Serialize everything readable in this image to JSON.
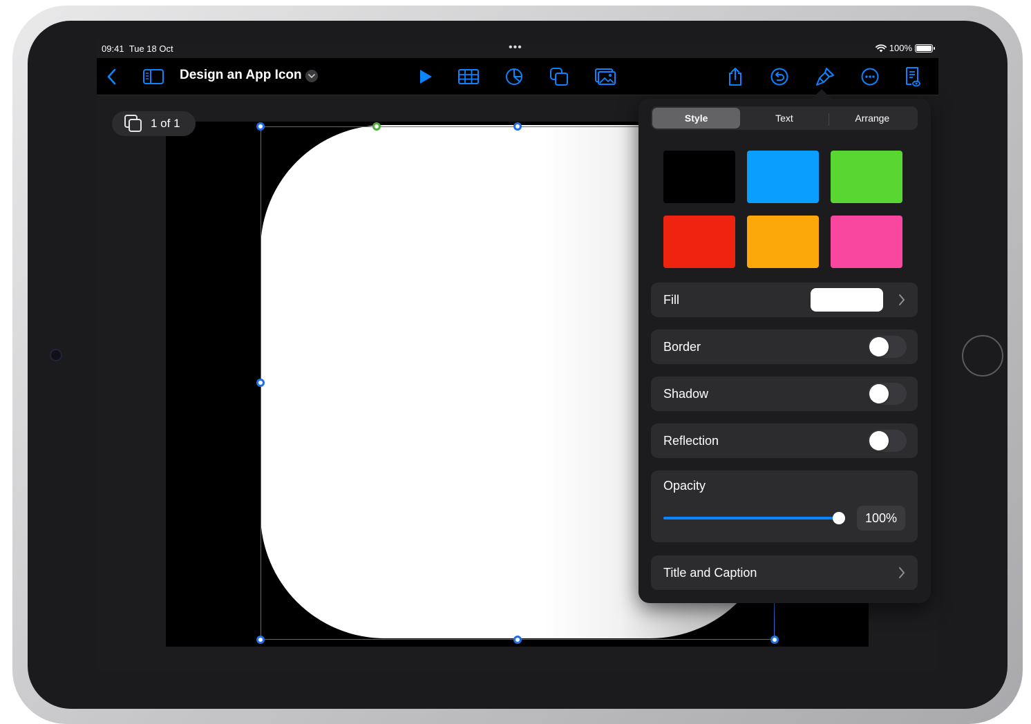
{
  "status_bar": {
    "time": "09:41",
    "date": "Tue 18 Oct",
    "multitask_dots": "•••",
    "battery": "100%"
  },
  "toolbar": {
    "document_title": "Design an App Icon",
    "icons": [
      "back-icon",
      "sidebar-icon",
      "play-icon",
      "table-icon",
      "chart-icon",
      "shapes-icon",
      "media-icon",
      "share-icon",
      "undo-icon",
      "format-brush-icon",
      "more-icon",
      "presenter-notes-icon"
    ],
    "accent_color": "#0a84ff"
  },
  "canvas": {
    "page_indicator": "1 of 1"
  },
  "format_popover": {
    "tabs": [
      {
        "label": "Style",
        "active": true
      },
      {
        "label": "Text",
        "active": false
      },
      {
        "label": "Arrange",
        "active": false
      }
    ],
    "style_swatches": [
      "#000000",
      "#0a9eff",
      "#5ad633",
      "#ee2411",
      "#fda80a",
      "#f9469f"
    ],
    "fill": {
      "label": "Fill",
      "color": "#ffffff"
    },
    "border": {
      "label": "Border",
      "on": false
    },
    "shadow": {
      "label": "Shadow",
      "on": false
    },
    "reflection": {
      "label": "Reflection",
      "on": false
    },
    "opacity": {
      "label": "Opacity",
      "value": "100%",
      "fraction": 1.0
    },
    "title_caption": {
      "label": "Title and Caption"
    }
  }
}
